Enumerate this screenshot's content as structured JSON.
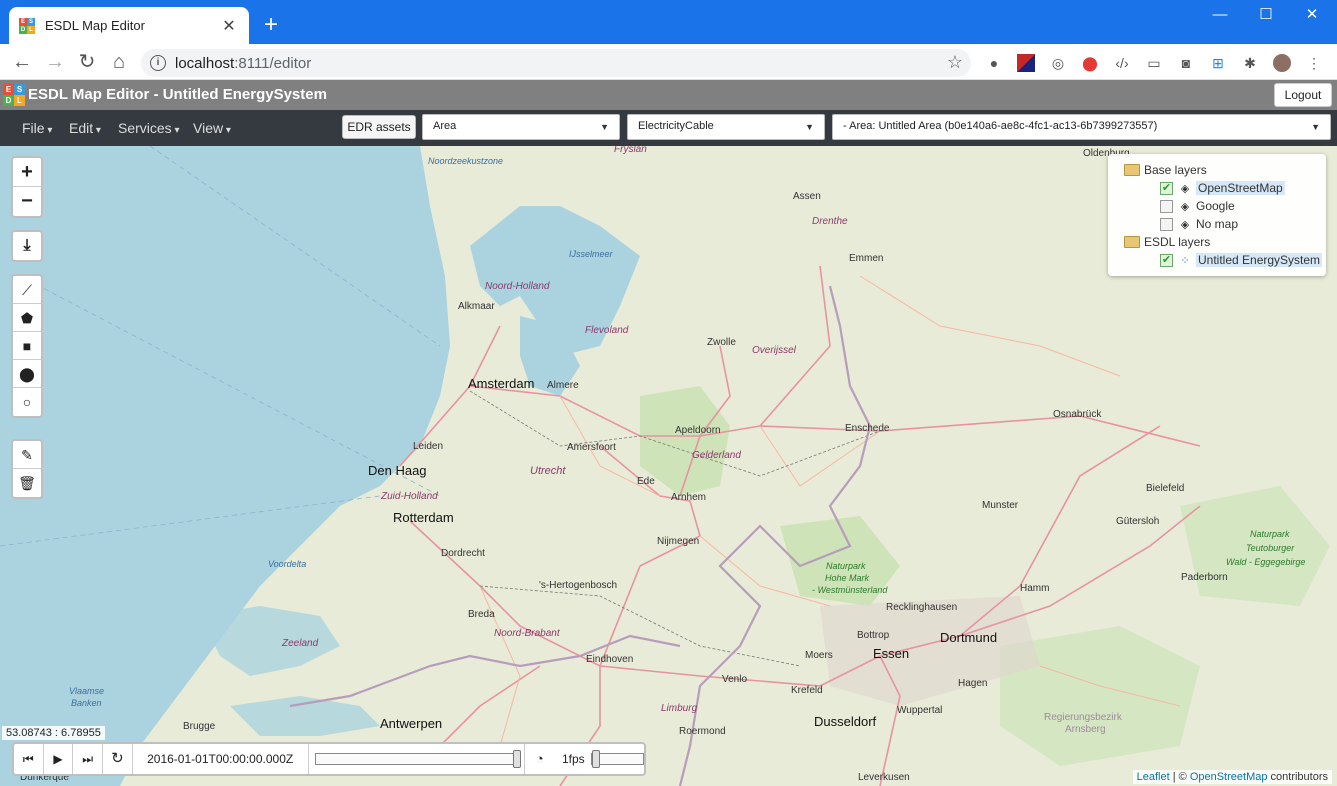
{
  "browser": {
    "tab_title": "ESDL Map Editor",
    "url_host": "localhost",
    "url_path": ":8111/editor"
  },
  "app": {
    "title": "ESDL Map Editor - Untitled EnergySystem",
    "logout_label": "Logout",
    "logo_letters": [
      "E",
      "S",
      "D",
      "L"
    ]
  },
  "menubar": {
    "menus": [
      "File",
      "Edit",
      "Services",
      "View"
    ],
    "edr_assets_label": "EDR assets",
    "area_select": "Area",
    "asset_select": "ElectricityCable",
    "area_tree_select": "- Area: Untitled Area (b0e140a6-ae8c-4fc1-ac13-6b7399273557)"
  },
  "map": {
    "places": {
      "amsterdam": "Amsterdam",
      "den_haag": "Den Haag",
      "rotterdam": "Rotterdam",
      "antwerpen": "Antwerpen",
      "dortmund": "Dortmund",
      "essen": "Essen",
      "dusseldorf": "Dusseldorf",
      "zwolle": "Zwolle",
      "assen": "Assen",
      "emmen": "Emmen",
      "apeldoorn": "Apeldoorn",
      "enschede": "Enschede",
      "osnabruck": "Osnabrück",
      "bielefeld": "Bielefeld",
      "munster": "Munster",
      "gutersloh": "Gütersloh",
      "paderborn": "Paderborn",
      "hamm": "Hamm",
      "recklinghausen": "Recklinghausen",
      "bottrop": "Bottrop",
      "moers": "Moers",
      "krefeld": "Krefeld",
      "hagen": "Hagen",
      "wuppertal": "Wuppertal",
      "leverkusen": "Leverkusen",
      "venlo": "Venlo",
      "roermond": "Roermond",
      "eindhoven": "Eindhoven",
      "s_hertogenbosch": "'s-Hertogenbosch",
      "nijmegen": "Nijmegen",
      "arnhem": "Arnhem",
      "ede": "Ede",
      "amersfoort": "Amersfoort",
      "utrecht": "Utrecht",
      "leiden": "Leiden",
      "alkmaar": "Alkmaar",
      "almere": "Almere",
      "dordrecht": "Dordrecht",
      "breda": "Breda",
      "brugge": "Brugge",
      "dunkerque": "Dunkerque",
      "oldenburg": "Oldenburg"
    },
    "regions": {
      "noord_holland": "Noord-Holland",
      "flevoland": "Flevoland",
      "overijssel": "Overijssel",
      "drenthe": "Drenthe",
      "gelderland": "Gelderland",
      "zuid_holland": "Zuid-Holland",
      "zeeland": "Zeeland",
      "noord_brabant": "Noord-Brabant",
      "limburg": "Limburg",
      "fryslan": "Fryslân",
      "regierungsbezirk": "Regierungsbezirk",
      "arnsberg": "Arnsberg"
    },
    "water": {
      "ijsselmeer": "IJsselmeer",
      "noordzeekustzone": "Noordzeekustzone",
      "voordelta": "Voordelta",
      "vlaamse_banken_1": "Vlaamse",
      "vlaamse_banken_2": "Banken"
    },
    "parks": {
      "teutoburger_1": "Naturpark",
      "teutoburger_2": "Teutoburger",
      "teutoburger_3": "Wald - Eggegebirge",
      "hohe_mark_1": "Naturpark",
      "hohe_mark_2": "Hohe Mark",
      "hohe_mark_3": "- Westmünsterland"
    },
    "controls": {
      "zoom_in": "+",
      "zoom_out": "−"
    }
  },
  "layers": {
    "base_group": "Base layers",
    "base_layers": [
      "OpenStreetMap",
      "Google",
      "No map"
    ],
    "esdl_group": "ESDL layers",
    "esdl_layers": [
      "Untitled EnergySystem"
    ]
  },
  "coords": "53.08743 : 6.78955",
  "timeline": {
    "timestamp": "2016-01-01T00:00:00.000Z",
    "fps": "1fps"
  },
  "attribution": {
    "leaflet": "Leaflet",
    "sep": " | © ",
    "osm": "OpenStreetMap",
    "suffix": " contributors"
  }
}
